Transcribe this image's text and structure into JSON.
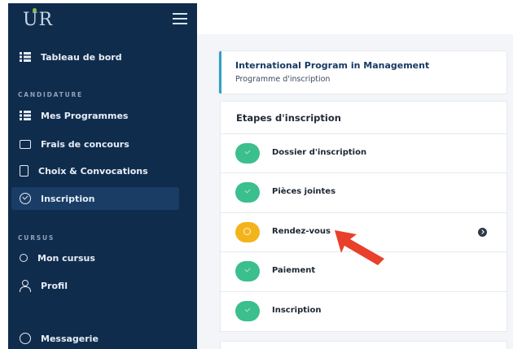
{
  "brand": {
    "logo_text": "UR",
    "accent_color": "#7dc242"
  },
  "sidebar": {
    "background": "#102c4d",
    "top_item": {
      "label": "Tableau de bord",
      "icon": "list-icon"
    },
    "sections": [
      {
        "title": "CANDIDATURE",
        "items": [
          {
            "label": "Mes Programmes",
            "icon": "list-icon"
          },
          {
            "label": "Frais de concours",
            "icon": "payment-card-icon"
          },
          {
            "label": "Choix & Convocations",
            "icon": "document-icon"
          },
          {
            "label": "Inscription",
            "icon": "check-circle-icon",
            "active": true
          }
        ]
      },
      {
        "title": "CURSUS",
        "items": [
          {
            "label": "Mon cursus",
            "icon": "medal-icon"
          },
          {
            "label": "Profil",
            "icon": "user-icon"
          }
        ]
      }
    ],
    "bottom_item": {
      "label": "Messagerie",
      "icon": "chat-icon"
    }
  },
  "program": {
    "title": "International Program in Management",
    "subtitle": "Programme d'inscription",
    "accent_color": "#2fa3c5"
  },
  "steps": {
    "header": "Etapes d'inscription",
    "completed_color": "#3bbf8c",
    "pending_color": "#f3b41b",
    "items": [
      {
        "label": "Dossier d'inscription",
        "status": "completed"
      },
      {
        "label": "Pièces jointes",
        "status": "completed"
      },
      {
        "label": "Rendez-vous",
        "status": "pending",
        "current": true
      },
      {
        "label": "Paiement",
        "status": "completed"
      },
      {
        "label": "Inscription",
        "status": "completed"
      }
    ]
  },
  "annotation": {
    "arrow_color": "#e8402a"
  }
}
